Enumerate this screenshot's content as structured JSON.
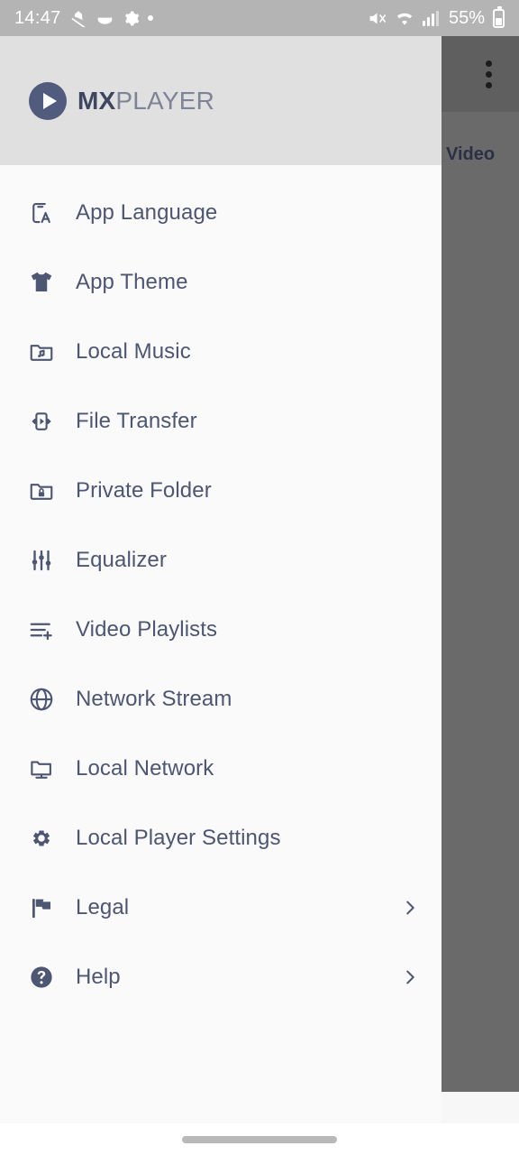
{
  "status_bar": {
    "time": "14:47",
    "battery_percent": "55%",
    "left_icons": [
      "silent-notification-icon",
      "cloud-icon",
      "gear-icon",
      "dot-icon"
    ],
    "right_icons": [
      "mute-icon",
      "wifi-icon",
      "signal-icon",
      "battery-icon"
    ]
  },
  "drawer": {
    "logo": {
      "brand_bold": "MX",
      "brand_light": "PLAYER",
      "mark": "play-circle-icon"
    },
    "items": [
      {
        "label": "App Language",
        "icon": "app-language-icon",
        "chevron": false
      },
      {
        "label": "App Theme",
        "icon": "tshirt-icon",
        "chevron": false
      },
      {
        "label": "Local Music",
        "icon": "music-folder-icon",
        "chevron": false
      },
      {
        "label": "File Transfer",
        "icon": "file-transfer-icon",
        "chevron": false
      },
      {
        "label": "Private Folder",
        "icon": "lock-folder-icon",
        "chevron": false
      },
      {
        "label": "Equalizer",
        "icon": "equalizer-icon",
        "chevron": false
      },
      {
        "label": "Video Playlists",
        "icon": "playlist-add-icon",
        "chevron": false
      },
      {
        "label": "Network Stream",
        "icon": "globe-icon",
        "chevron": false
      },
      {
        "label": "Local Network",
        "icon": "monitor-icon",
        "chevron": false
      },
      {
        "label": "Local Player Settings",
        "icon": "gear-icon",
        "chevron": false
      },
      {
        "label": "Legal",
        "icon": "flag-icon",
        "chevron": true
      },
      {
        "label": "Help",
        "icon": "help-circle-icon",
        "chevron": true
      }
    ],
    "chevron_glyph": "›"
  },
  "background_app": {
    "overflow_menu": "more-vertical-icon",
    "row_label": "Video",
    "row_icon": "playlist-add-icon"
  },
  "navigation_bar": {
    "gesture_pill": "home-gesture-pill"
  },
  "colors": {
    "accent": "#4d5672",
    "header_bg": "#e0e0e0",
    "drawer_bg": "#fafafa",
    "scrim": "#6a6a6a",
    "status_bg": "#b4b4b4"
  }
}
